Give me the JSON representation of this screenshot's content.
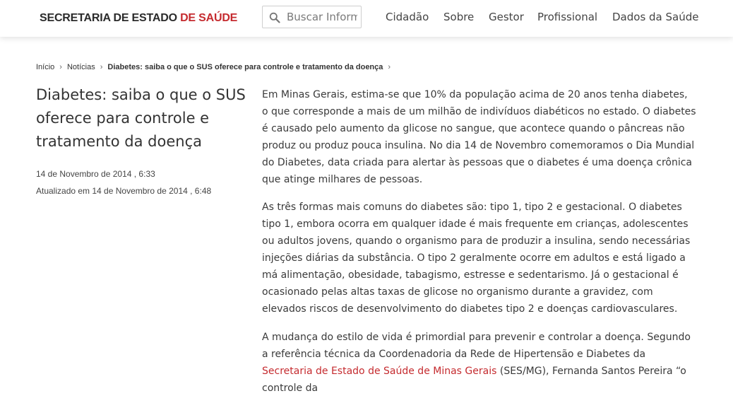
{
  "header": {
    "brand_main": "SECRETARIA DE ESTADO ",
    "brand_accent": "DE SAÚDE",
    "search_placeholder": "Buscar Inform",
    "nav": [
      "Cidadão",
      "Sobre",
      "Gestor",
      "Profissional",
      "Dados da Saúde"
    ]
  },
  "breadcrumb": {
    "items": [
      "Início",
      "Notícias",
      "Diabetes: saiba o que o SUS oferece para controle e tratamento da doença"
    ],
    "separator": "›"
  },
  "article": {
    "title": "Diabetes: saiba o que o SUS oferece para controle e tratamento da doença",
    "published": "14 de Novembro de 2014 , 6:33",
    "updated": "Atualizado em 14 de Novembro de 2014 , 6:48",
    "paragraphs": [
      "Em Minas Gerais, estima-se que 10% da população acima de 20 anos tenha diabetes, o que corresponde a mais de um milhão de indivíduos diabéticos no estado.  O diabetes é causado pelo aumento da glicose no sangue, que acontece quando o pâncreas não produz ou produz pouca insulina. No dia 14 de Novembro comemoramos o Dia Mundial do Diabetes, data criada para alertar às pessoas que o diabetes é uma doença crônica que atinge milhares de pessoas.",
      "As três formas mais comuns do diabetes são: tipo 1, tipo 2 e gestacional. O diabetes tipo 1, embora ocorra em qualquer idade é mais frequente em crianças, adolescentes ou adultos jovens, quando o organismo para de produzir a insulina, sendo necessárias injeções diárias da substância. O tipo 2 geralmente ocorre em adultos e está ligado a má alimentação, obesidade, tabagismo, estresse e sedentarismo. Já o gestacional é ocasionado pelas altas taxas de glicose no organismo durante a gravidez, com elevados riscos de desenvolvimento do diabetes tipo 2 e doenças cardiovasculares."
    ],
    "p3_before": "A mudança do estilo de vida é primordial para prevenir e controlar a doença. Segundo a referência técnica da Coordenadoria da Rede de Hipertensão e Diabetes da ",
    "p3_link": "Secretaria de Estado de Saúde de Minas Gerais",
    "p3_after": " (SES/MG), Fernanda Santos Pereira “o controle da"
  },
  "colors": {
    "accent": "#c52b2f",
    "text": "#3a3a3a"
  }
}
